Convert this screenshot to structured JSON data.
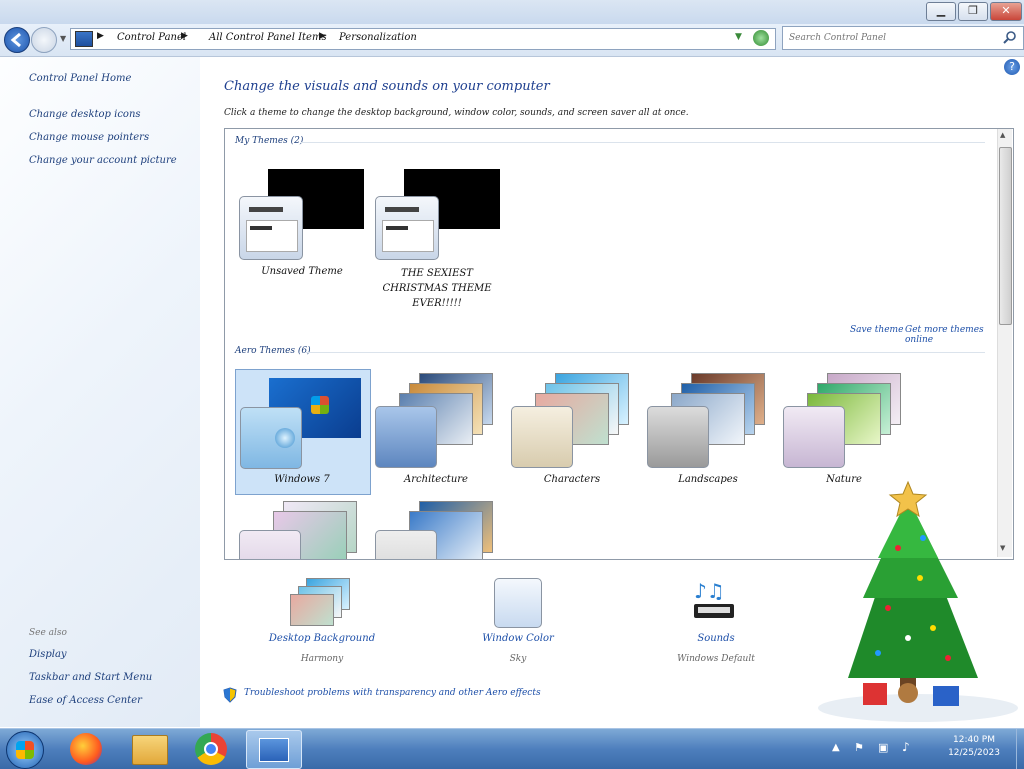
{
  "window": {
    "minimize": "▁",
    "restore": "❐",
    "close": "✕"
  },
  "address": {
    "crumbs": [
      "Control Panel",
      "All Control Panel Items",
      "Personalization"
    ],
    "search_placeholder": "Search Control Panel"
  },
  "sidebar": {
    "home": "Control Panel Home",
    "links": [
      "Change desktop icons",
      "Change mouse pointers",
      "Change your account picture"
    ],
    "see_also_label": "See also",
    "see_also": [
      "Display",
      "Taskbar and Start Menu",
      "Ease of Access Center"
    ]
  },
  "main": {
    "heading": "Change the visuals and sounds on your computer",
    "instructions": "Click a theme to change the desktop background, window color, sounds, and screen saver all at once.",
    "my_themes_header": "My Themes (2)",
    "my_themes": [
      {
        "label": "Unsaved Theme"
      },
      {
        "label": "THE SEXIEST CHRISTMAS THEME EVER!!!!!"
      }
    ],
    "save_theme": "Save theme",
    "get_more_online": "Get more themes online",
    "aero_header": "Aero Themes (6)",
    "aero_themes": [
      {
        "label": "Windows 7"
      },
      {
        "label": "Architecture"
      },
      {
        "label": "Characters"
      },
      {
        "label": "Landscapes"
      },
      {
        "label": "Nature"
      }
    ],
    "bottom": {
      "background_label": "Desktop Background",
      "background_sub": "Harmony",
      "color_label": "Window Color",
      "color_sub": "Sky",
      "sounds_label": "Sounds",
      "sounds_sub": "Windows Default"
    },
    "troubleshoot": "Troubleshoot problems with transparency and other Aero effects"
  },
  "taskbar": {
    "clock_time": "12:40 PM",
    "clock_date": "12/25/2023"
  },
  "colors": {
    "accent": "#1e3f8f",
    "link": "#1d4fa8",
    "selection": "#cde3f8"
  }
}
